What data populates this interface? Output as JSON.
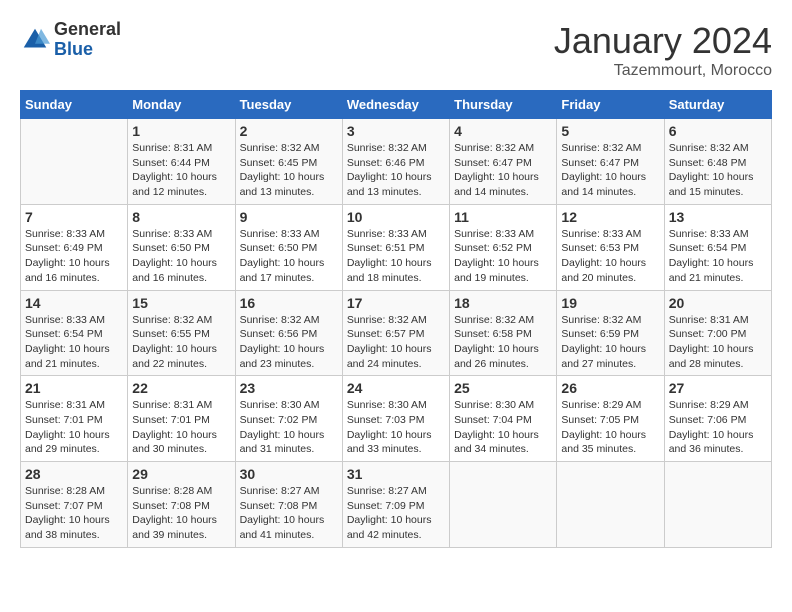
{
  "header": {
    "logo": {
      "general": "General",
      "blue": "Blue"
    },
    "month": "January 2024",
    "location": "Tazemmourt, Morocco"
  },
  "weekdays": [
    "Sunday",
    "Monday",
    "Tuesday",
    "Wednesday",
    "Thursday",
    "Friday",
    "Saturday"
  ],
  "weeks": [
    [
      {
        "day": "",
        "info": ""
      },
      {
        "day": "1",
        "info": "Sunrise: 8:31 AM\nSunset: 6:44 PM\nDaylight: 10 hours\nand 12 minutes."
      },
      {
        "day": "2",
        "info": "Sunrise: 8:32 AM\nSunset: 6:45 PM\nDaylight: 10 hours\nand 13 minutes."
      },
      {
        "day": "3",
        "info": "Sunrise: 8:32 AM\nSunset: 6:46 PM\nDaylight: 10 hours\nand 13 minutes."
      },
      {
        "day": "4",
        "info": "Sunrise: 8:32 AM\nSunset: 6:47 PM\nDaylight: 10 hours\nand 14 minutes."
      },
      {
        "day": "5",
        "info": "Sunrise: 8:32 AM\nSunset: 6:47 PM\nDaylight: 10 hours\nand 14 minutes."
      },
      {
        "day": "6",
        "info": "Sunrise: 8:32 AM\nSunset: 6:48 PM\nDaylight: 10 hours\nand 15 minutes."
      }
    ],
    [
      {
        "day": "7",
        "info": "Sunrise: 8:33 AM\nSunset: 6:49 PM\nDaylight: 10 hours\nand 16 minutes."
      },
      {
        "day": "8",
        "info": "Sunrise: 8:33 AM\nSunset: 6:50 PM\nDaylight: 10 hours\nand 16 minutes."
      },
      {
        "day": "9",
        "info": "Sunrise: 8:33 AM\nSunset: 6:50 PM\nDaylight: 10 hours\nand 17 minutes."
      },
      {
        "day": "10",
        "info": "Sunrise: 8:33 AM\nSunset: 6:51 PM\nDaylight: 10 hours\nand 18 minutes."
      },
      {
        "day": "11",
        "info": "Sunrise: 8:33 AM\nSunset: 6:52 PM\nDaylight: 10 hours\nand 19 minutes."
      },
      {
        "day": "12",
        "info": "Sunrise: 8:33 AM\nSunset: 6:53 PM\nDaylight: 10 hours\nand 20 minutes."
      },
      {
        "day": "13",
        "info": "Sunrise: 8:33 AM\nSunset: 6:54 PM\nDaylight: 10 hours\nand 21 minutes."
      }
    ],
    [
      {
        "day": "14",
        "info": "Sunrise: 8:33 AM\nSunset: 6:54 PM\nDaylight: 10 hours\nand 21 minutes."
      },
      {
        "day": "15",
        "info": "Sunrise: 8:32 AM\nSunset: 6:55 PM\nDaylight: 10 hours\nand 22 minutes."
      },
      {
        "day": "16",
        "info": "Sunrise: 8:32 AM\nSunset: 6:56 PM\nDaylight: 10 hours\nand 23 minutes."
      },
      {
        "day": "17",
        "info": "Sunrise: 8:32 AM\nSunset: 6:57 PM\nDaylight: 10 hours\nand 24 minutes."
      },
      {
        "day": "18",
        "info": "Sunrise: 8:32 AM\nSunset: 6:58 PM\nDaylight: 10 hours\nand 26 minutes."
      },
      {
        "day": "19",
        "info": "Sunrise: 8:32 AM\nSunset: 6:59 PM\nDaylight: 10 hours\nand 27 minutes."
      },
      {
        "day": "20",
        "info": "Sunrise: 8:31 AM\nSunset: 7:00 PM\nDaylight: 10 hours\nand 28 minutes."
      }
    ],
    [
      {
        "day": "21",
        "info": "Sunrise: 8:31 AM\nSunset: 7:01 PM\nDaylight: 10 hours\nand 29 minutes."
      },
      {
        "day": "22",
        "info": "Sunrise: 8:31 AM\nSunset: 7:01 PM\nDaylight: 10 hours\nand 30 minutes."
      },
      {
        "day": "23",
        "info": "Sunrise: 8:30 AM\nSunset: 7:02 PM\nDaylight: 10 hours\nand 31 minutes."
      },
      {
        "day": "24",
        "info": "Sunrise: 8:30 AM\nSunset: 7:03 PM\nDaylight: 10 hours\nand 33 minutes."
      },
      {
        "day": "25",
        "info": "Sunrise: 8:30 AM\nSunset: 7:04 PM\nDaylight: 10 hours\nand 34 minutes."
      },
      {
        "day": "26",
        "info": "Sunrise: 8:29 AM\nSunset: 7:05 PM\nDaylight: 10 hours\nand 35 minutes."
      },
      {
        "day": "27",
        "info": "Sunrise: 8:29 AM\nSunset: 7:06 PM\nDaylight: 10 hours\nand 36 minutes."
      }
    ],
    [
      {
        "day": "28",
        "info": "Sunrise: 8:28 AM\nSunset: 7:07 PM\nDaylight: 10 hours\nand 38 minutes."
      },
      {
        "day": "29",
        "info": "Sunrise: 8:28 AM\nSunset: 7:08 PM\nDaylight: 10 hours\nand 39 minutes."
      },
      {
        "day": "30",
        "info": "Sunrise: 8:27 AM\nSunset: 7:08 PM\nDaylight: 10 hours\nand 41 minutes."
      },
      {
        "day": "31",
        "info": "Sunrise: 8:27 AM\nSunset: 7:09 PM\nDaylight: 10 hours\nand 42 minutes."
      },
      {
        "day": "",
        "info": ""
      },
      {
        "day": "",
        "info": ""
      },
      {
        "day": "",
        "info": ""
      }
    ]
  ]
}
